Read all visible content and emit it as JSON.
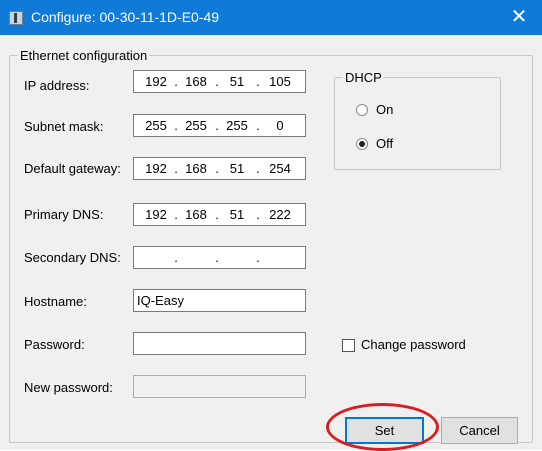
{
  "window": {
    "title": "Configure: 00-30-11-1D-E0-49",
    "close_glyph": "✕"
  },
  "ethernet": {
    "group_title": "Ethernet configuration",
    "ip_address": {
      "label": "IP address:",
      "octets": [
        "192",
        "168",
        "51",
        "105"
      ]
    },
    "subnet_mask": {
      "label": "Subnet mask:",
      "octets": [
        "255",
        "255",
        "255",
        "0"
      ]
    },
    "default_gateway": {
      "label": "Default gateway:",
      "octets": [
        "192",
        "168",
        "51",
        "254"
      ]
    },
    "primary_dns": {
      "label": "Primary DNS:",
      "octets": [
        "192",
        "168",
        "51",
        "222"
      ]
    },
    "secondary_dns": {
      "label": "Secondary DNS:",
      "octets": [
        "",
        "",
        "",
        ""
      ]
    },
    "hostname": {
      "label": "Hostname:",
      "value": "IQ-Easy"
    },
    "password": {
      "label": "Password:",
      "value": ""
    },
    "new_password": {
      "label": "New password:",
      "value": ""
    },
    "dot": "."
  },
  "dhcp": {
    "group_title": "DHCP",
    "on_label": "On",
    "off_label": "Off",
    "selected": "Off"
  },
  "change_password": {
    "label": "Change password",
    "checked": false
  },
  "buttons": {
    "set": "Set",
    "cancel": "Cancel"
  },
  "colors": {
    "titlebar": "#0f7ad8",
    "annotation": "#d81e1e"
  }
}
